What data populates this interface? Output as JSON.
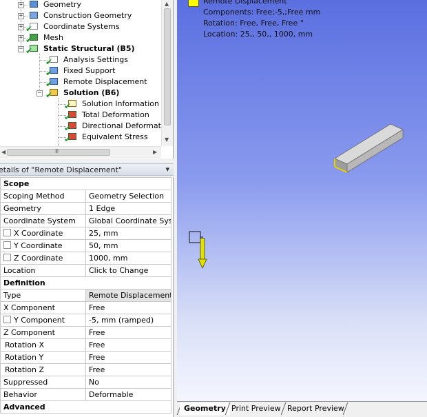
{
  "tree": {
    "items": [
      {
        "label": "Geometry",
        "bold": false
      },
      {
        "label": "Construction Geometry",
        "bold": false
      },
      {
        "label": "Coordinate Systems",
        "bold": false
      },
      {
        "label": "Mesh",
        "bold": false
      },
      {
        "label": "Static Structural (B5)",
        "bold": true
      },
      {
        "label": "Analysis Settings",
        "bold": false
      },
      {
        "label": "Fixed Support",
        "bold": false
      },
      {
        "label": "Remote Displacement",
        "bold": false
      },
      {
        "label": "Solution (B6)",
        "bold": true
      },
      {
        "label": "Solution Information",
        "bold": false
      },
      {
        "label": "Total Deformation",
        "bold": false
      },
      {
        "label": "Directional Deformatic",
        "bold": false
      },
      {
        "label": "Equivalent Stress",
        "bold": false
      }
    ],
    "expand_plus": "+",
    "expand_minus": "−",
    "scroll_grip": "III",
    "arrow_left": "◀",
    "arrow_right": "▶",
    "arrow_up": "▲",
    "arrow_down": "▼"
  },
  "details": {
    "title": "etails of \"Remote Displacement\"",
    "pin": "ᵖ",
    "rows": [
      {
        "group": "Scope"
      },
      {
        "key": "Scoping Method",
        "value": "Geometry Selection"
      },
      {
        "key": "Geometry",
        "value": "1 Edge"
      },
      {
        "key": "Coordinate System",
        "value": "Global Coordinate System"
      },
      {
        "key": "X Coordinate",
        "value": "25, mm",
        "checkbox": true
      },
      {
        "key": "Y Coordinate",
        "value": "50, mm",
        "checkbox": true
      },
      {
        "key": "Z Coordinate",
        "value": "1000, mm",
        "checkbox": true
      },
      {
        "key": "Location",
        "value": "Click to Change"
      },
      {
        "group": "Definition"
      },
      {
        "key": "Type",
        "value": "Remote Displacement",
        "selected": true
      },
      {
        "key": "X Component",
        "value": "Free"
      },
      {
        "key": "Y Component",
        "value": "-5, mm  (ramped)",
        "checkbox": true
      },
      {
        "key": "Z Component",
        "value": "Free"
      },
      {
        "key": "Rotation X",
        "value": "Free",
        "indent": true
      },
      {
        "key": "Rotation Y",
        "value": "Free",
        "indent": true
      },
      {
        "key": "Rotation Z",
        "value": "Free",
        "indent": true
      },
      {
        "key": "Suppressed",
        "value": "No"
      },
      {
        "key": "Behavior",
        "value": "Deformable"
      },
      {
        "group": "Advanced"
      }
    ]
  },
  "viewport": {
    "legend_title": "Remote Displacement",
    "components": "Components: Free;-5,;Free mm",
    "rotation": "Rotation: Free, Free, Free °",
    "location": "Location: 25,, 50,, 1000, mm",
    "background_top": "#5b6fe0",
    "background_bottom": "#f4f6ff",
    "marker_color": "#ffff00"
  },
  "tabs": [
    {
      "label": "Geometry",
      "active": true
    },
    {
      "label": "Print Preview",
      "active": false
    },
    {
      "label": "Report Preview",
      "active": false
    }
  ]
}
